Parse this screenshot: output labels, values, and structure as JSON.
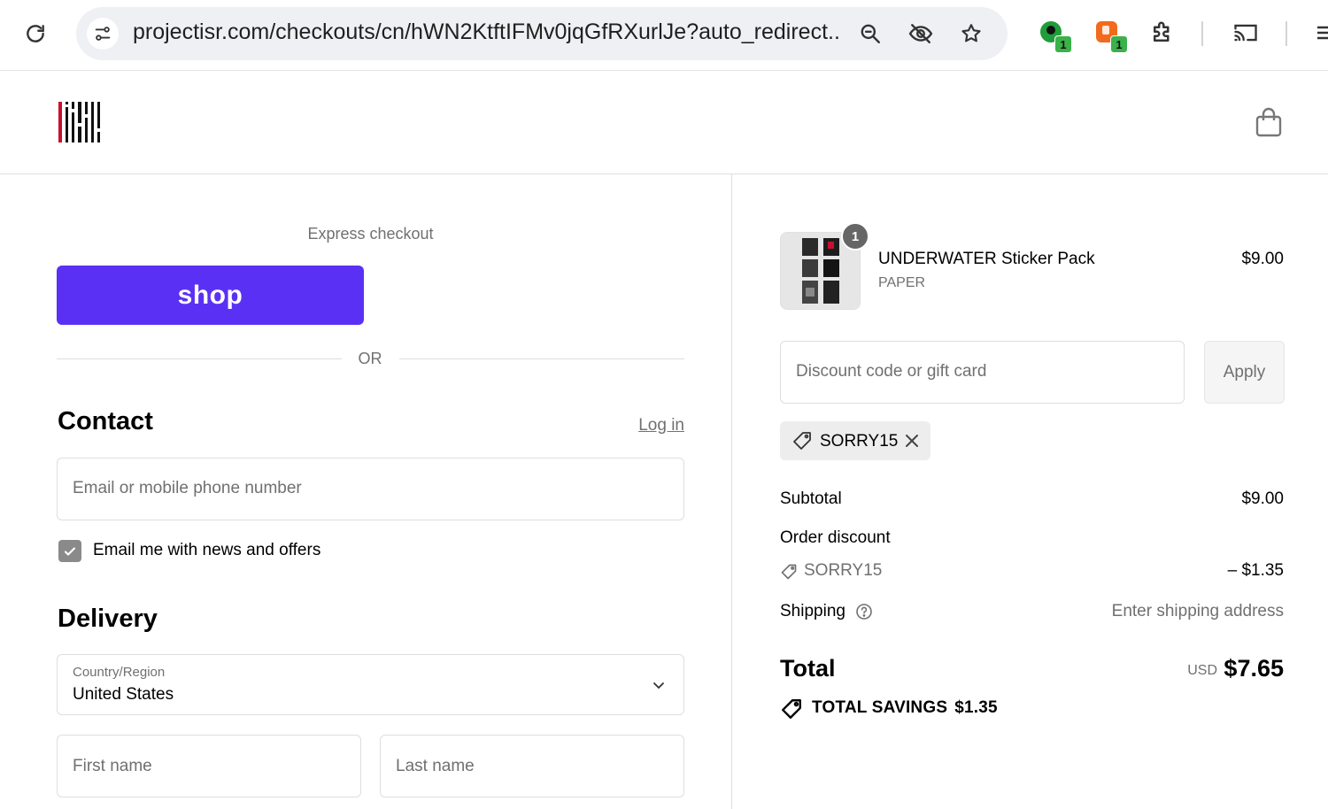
{
  "browser": {
    "url": "projectisr.com/checkouts/cn/hWN2KtftIFMv0jqGfRXurlJe?auto_redirect...",
    "extensions": [
      {
        "name": "ext-green",
        "badge": "1",
        "color": "#1f9d3a"
      },
      {
        "name": "ext-orange",
        "badge": "1",
        "color": "#f26b1d"
      }
    ]
  },
  "store": {
    "brand_colors": {
      "red": "#c8102e",
      "dark": "#111111"
    }
  },
  "checkout": {
    "express_label": "Express checkout",
    "shop_button": "shop",
    "shop_color": "#5a31f4",
    "or_label": "OR",
    "contact": {
      "title": "Contact",
      "login_link": "Log in",
      "email_placeholder": "Email or mobile phone number",
      "newsletter_label": "Email me with news and offers",
      "newsletter_checked": true
    },
    "delivery": {
      "title": "Delivery",
      "country_label": "Country/Region",
      "country_value": "United States",
      "first_name_placeholder": "First name",
      "last_name_placeholder": "Last name"
    }
  },
  "summary": {
    "product": {
      "quantity": "1",
      "name": "UNDERWATER Sticker Pack",
      "variant": "PAPER",
      "price": "$9.00"
    },
    "discount_placeholder": "Discount code or gift card",
    "apply_label": "Apply",
    "applied_code": "SORRY15",
    "subtotal_label": "Subtotal",
    "subtotal_value": "$9.00",
    "order_discount_label": "Order discount",
    "discount_code": "SORRY15",
    "discount_value": "– $1.35",
    "shipping_label": "Shipping",
    "shipping_value": "Enter shipping address",
    "total_label": "Total",
    "total_currency": "USD",
    "total_value": "$7.65",
    "savings_label": "TOTAL SAVINGS",
    "savings_value": "$1.35"
  }
}
